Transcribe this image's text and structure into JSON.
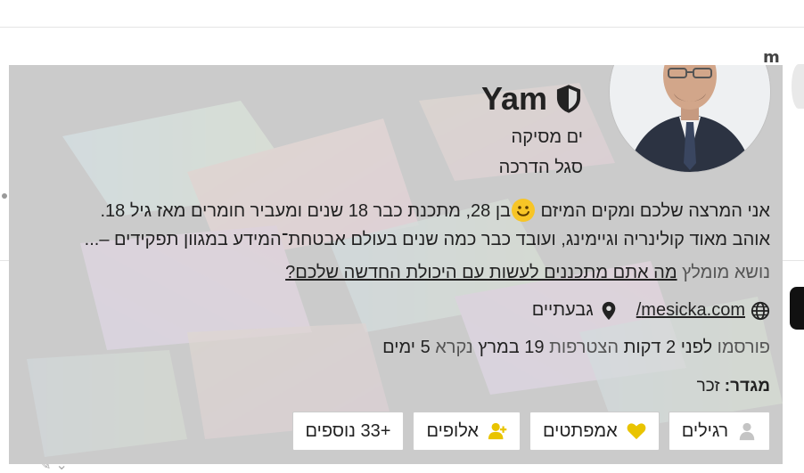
{
  "background": {
    "name_hint": "m"
  },
  "user_card": {
    "display_name": "Yam",
    "username": "ים מסיקה",
    "title": "סגל הדרכה",
    "bio_line_1_start": "אני המרצה שלכם ומקים המיזם ",
    "bio_line_1_end": "בן 28, מתכנת כבר 18 שנים ומעביר חומרים מאז גיל 18.",
    "bio_line_2": "אוהב מאוד קולינריה וגיימינג, ועובד כבר כמה שנים בעולם אבטחת־המידע במגוון תפקידים –...",
    "favorite_topic_label": "נושא מומלץ",
    "favorite_topic": "מה אתם מתכננים לעשות עם היכולת החדשה שלכם?",
    "website": "mesicka.com/",
    "location": "גבעתיים",
    "stats": {
      "posted_label": "פורסמו",
      "posted_value": "לפני 2 דקות",
      "joined_label": "הצטרפות",
      "joined_value": "19 במרץ",
      "read_label": "נקרא",
      "read_value": "5 ימים"
    },
    "gender_label": "מגדר:",
    "gender_value": "זכר",
    "badges": [
      {
        "label": "רגילים",
        "icon": "user-icon",
        "color": "#c4c4c4"
      },
      {
        "label": "אמפתטים",
        "icon": "heart-icon",
        "color": "#e9c400"
      },
      {
        "label": "אלופים",
        "icon": "user-plus-icon",
        "color": "#e9c400"
      },
      {
        "label": "+33 נוספים",
        "icon": "",
        "color": ""
      }
    ]
  },
  "colors": {
    "card_bg": "#dcdcdc",
    "badge_gold": "#e9c400",
    "badge_gray": "#c4c4c4"
  }
}
